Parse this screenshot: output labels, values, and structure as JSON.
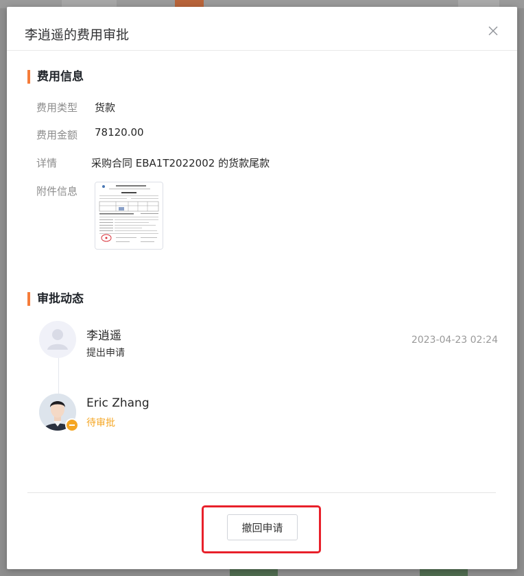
{
  "dialog": {
    "title": "李逍遥的费用审批"
  },
  "expense_info": {
    "section_title": "费用信息",
    "fields": [
      {
        "label": "费用类型",
        "value": "货款"
      },
      {
        "label": "费用金额",
        "value": "78120.00"
      },
      {
        "label": "详情",
        "value": "采购合同 EBA1T2022002 的货款尾款"
      },
      {
        "label": "附件信息"
      }
    ]
  },
  "approval": {
    "section_title": "审批动态",
    "steps": [
      {
        "name": "李逍遥",
        "action": "提出申请",
        "time": "2023-04-23 02:24",
        "action_color": "#333333"
      },
      {
        "name": "Eric Zhang",
        "action": "待审批",
        "action_color": "#f5a623"
      }
    ]
  },
  "footer": {
    "revoke_label": "撤回申请"
  },
  "colors": {
    "accent": "#f57c3a",
    "pending": "#f5a623",
    "annotation": "#e8202a"
  },
  "icons": {
    "close": "close-icon",
    "badge": "pending-minus-icon"
  }
}
